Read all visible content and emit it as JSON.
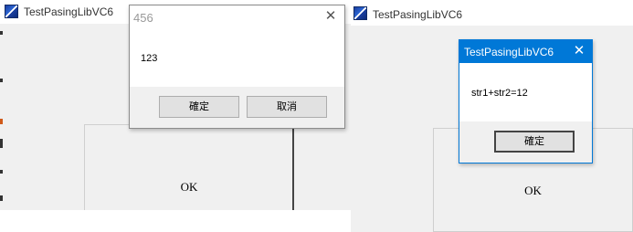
{
  "left_app": {
    "title": "TestPasingLibVC6",
    "icon": "app-icon",
    "ok_label": "OK"
  },
  "dialog_456": {
    "title": "456",
    "message": "123",
    "ok_label": "確定",
    "cancel_label": "取消",
    "close_icon": "close-icon"
  },
  "right_app": {
    "title": "TestPasingLibVC6",
    "icon": "app-icon",
    "ok_label": "OK"
  },
  "dialog_result": {
    "title": "TestPasingLibVC6",
    "message": "str1+str2=12",
    "ok_label": "確定",
    "close_icon": "close-icon",
    "title_bar_color": "#0078d7"
  }
}
